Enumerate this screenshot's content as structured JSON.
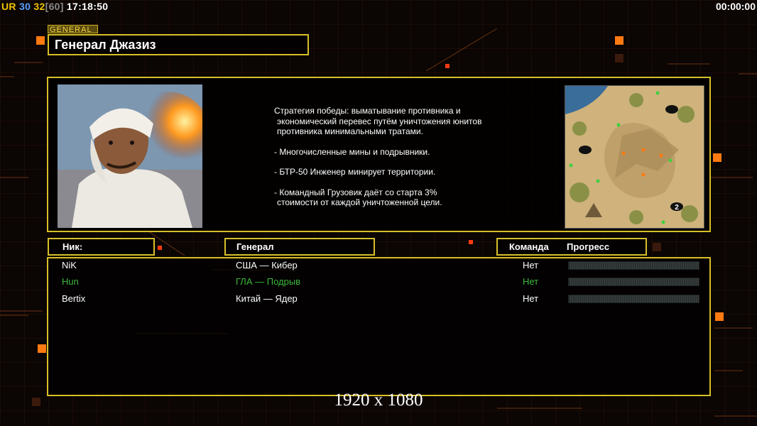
{
  "hud": {
    "ur_label": "UR",
    "fps_a": "30",
    "fps_b": "32",
    "fps_cap": "[60]",
    "clock": "17:18:50",
    "timer": "00:00:00"
  },
  "general_tag": "GENERAL",
  "title": "Генерал Джазиз",
  "description": {
    "strategy_line1": "Стратегия победы: выматывание противника и",
    "strategy_line2": "экономический перевес путём уничтожения юнитов",
    "strategy_line3": "противника минимальными тратами.",
    "bullet1": "- Многочисленные мины и подрывники.",
    "bullet2": "- БТР-50 Инженер минирует территории.",
    "bullet3_line1": "- Командный Грузовик даёт со старта 3%",
    "bullet3_line2": "стоимости от каждой уничтоженной цели."
  },
  "minimap": {
    "player_marker": "2"
  },
  "columns": {
    "nick": "Ник:",
    "general": "Генерал",
    "team": "Команда",
    "progress": "Прогресс"
  },
  "players": [
    {
      "nick": "NiK",
      "general": "США — Кибер",
      "team": "Нет",
      "progress": 0,
      "color": "#ffffff"
    },
    {
      "nick": "Hun",
      "general": "ГЛА — Подрыв",
      "team": "Нет",
      "progress": 0,
      "color": "#3db83d"
    },
    {
      "nick": "Bertix",
      "general": "Китай — Ядер",
      "team": "Нет",
      "progress": 0,
      "color": "#ffffff"
    }
  ],
  "resolution_label": "1920 x 1080",
  "colors": {
    "frame": "#d7bf28",
    "accent_orange": "#ff7a10",
    "hun_green": "#3db83d"
  }
}
